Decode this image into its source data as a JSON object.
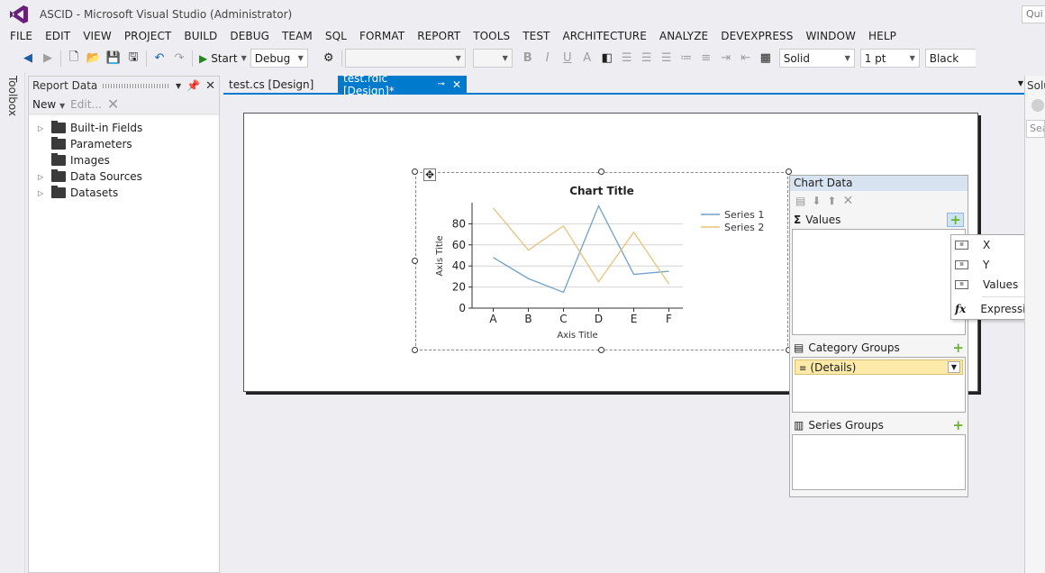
{
  "window": {
    "title": "ASCID - Microsoft Visual Studio (Administrator)",
    "quick_launch": "Qui"
  },
  "menu": [
    "FILE",
    "EDIT",
    "VIEW",
    "PROJECT",
    "BUILD",
    "DEBUG",
    "TEAM",
    "SQL",
    "FORMAT",
    "REPORT",
    "TOOLS",
    "TEST",
    "ARCHITECTURE",
    "ANALYZE",
    "DEVEXPRESS",
    "WINDOW",
    "HELP"
  ],
  "toolbar": {
    "start_label": "Start",
    "config": "Debug",
    "line_style": "Solid",
    "line_width": "1 pt",
    "line_color": "Black"
  },
  "toolbox": {
    "label": "Toolbox"
  },
  "report_data": {
    "title": "Report Data",
    "new_label": "New",
    "edit_label": "Edit...",
    "items": [
      {
        "label": "Built-in Fields",
        "expandable": true
      },
      {
        "label": "Parameters",
        "expandable": false
      },
      {
        "label": "Images",
        "expandable": false
      },
      {
        "label": "Data Sources",
        "expandable": true
      },
      {
        "label": "Datasets",
        "expandable": true
      }
    ]
  },
  "tabs": [
    {
      "label": "test.cs [Design]",
      "active": false
    },
    {
      "label": "test.rdlc [Design]*",
      "active": true
    }
  ],
  "chart_data": {
    "type": "line",
    "title": "Chart Title",
    "xlabel": "Axis Title",
    "ylabel": "Axis Title",
    "categories": [
      "A",
      "B",
      "C",
      "D",
      "E",
      "F"
    ],
    "yticks": [
      0,
      20,
      40,
      60,
      80
    ],
    "ylim": [
      0,
      100
    ],
    "grid": true,
    "legend": "top-right",
    "series": [
      {
        "name": "Series 1",
        "color": "#6fa1c9",
        "values": [
          48,
          28,
          15,
          97,
          32,
          35
        ]
      },
      {
        "name": "Series 2",
        "color": "#e8c27a",
        "values": [
          95,
          55,
          78,
          25,
          72,
          23
        ]
      }
    ]
  },
  "chart_data_panel": {
    "title": "Chart Data",
    "values_label": "Values",
    "category_groups_label": "Category Groups",
    "category_group_item": "(Details)",
    "series_groups_label": "Series Groups"
  },
  "values_dropdown": [
    "X",
    "Y",
    "Values",
    "Expression..."
  ],
  "solution_explorer": {
    "title": "Solu",
    "search": "Sea"
  }
}
